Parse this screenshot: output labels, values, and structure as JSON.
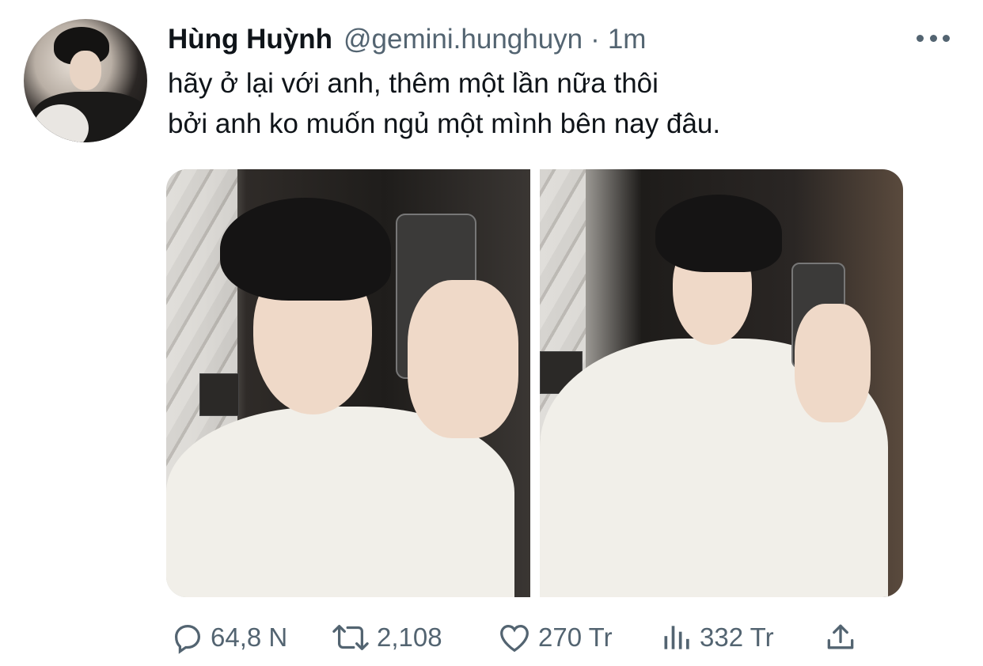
{
  "tweet": {
    "display_name": "Hùng Huỳnh",
    "handle": "@gemini.hunghuyn",
    "separator": "·",
    "time": "1m",
    "lines": [
      "hãy ở lại với anh, thêm một lần nữa thôi",
      "bởi anh ko muốn ngủ một mình bên nay đâu."
    ]
  },
  "media": {
    "photos": [
      {
        "description_icon": "photo"
      },
      {
        "description_icon": "photo"
      }
    ]
  },
  "actions": {
    "replies": "64,8 N",
    "retweets": "2,108",
    "likes": "270 Tr",
    "views": "332 Tr"
  },
  "colors": {
    "text_primary": "#0f1419",
    "text_secondary": "#536471",
    "background": "#ffffff"
  },
  "icons": [
    "more-icon",
    "reply-icon",
    "retweet-icon",
    "like-icon",
    "views-icon",
    "share-icon"
  ]
}
